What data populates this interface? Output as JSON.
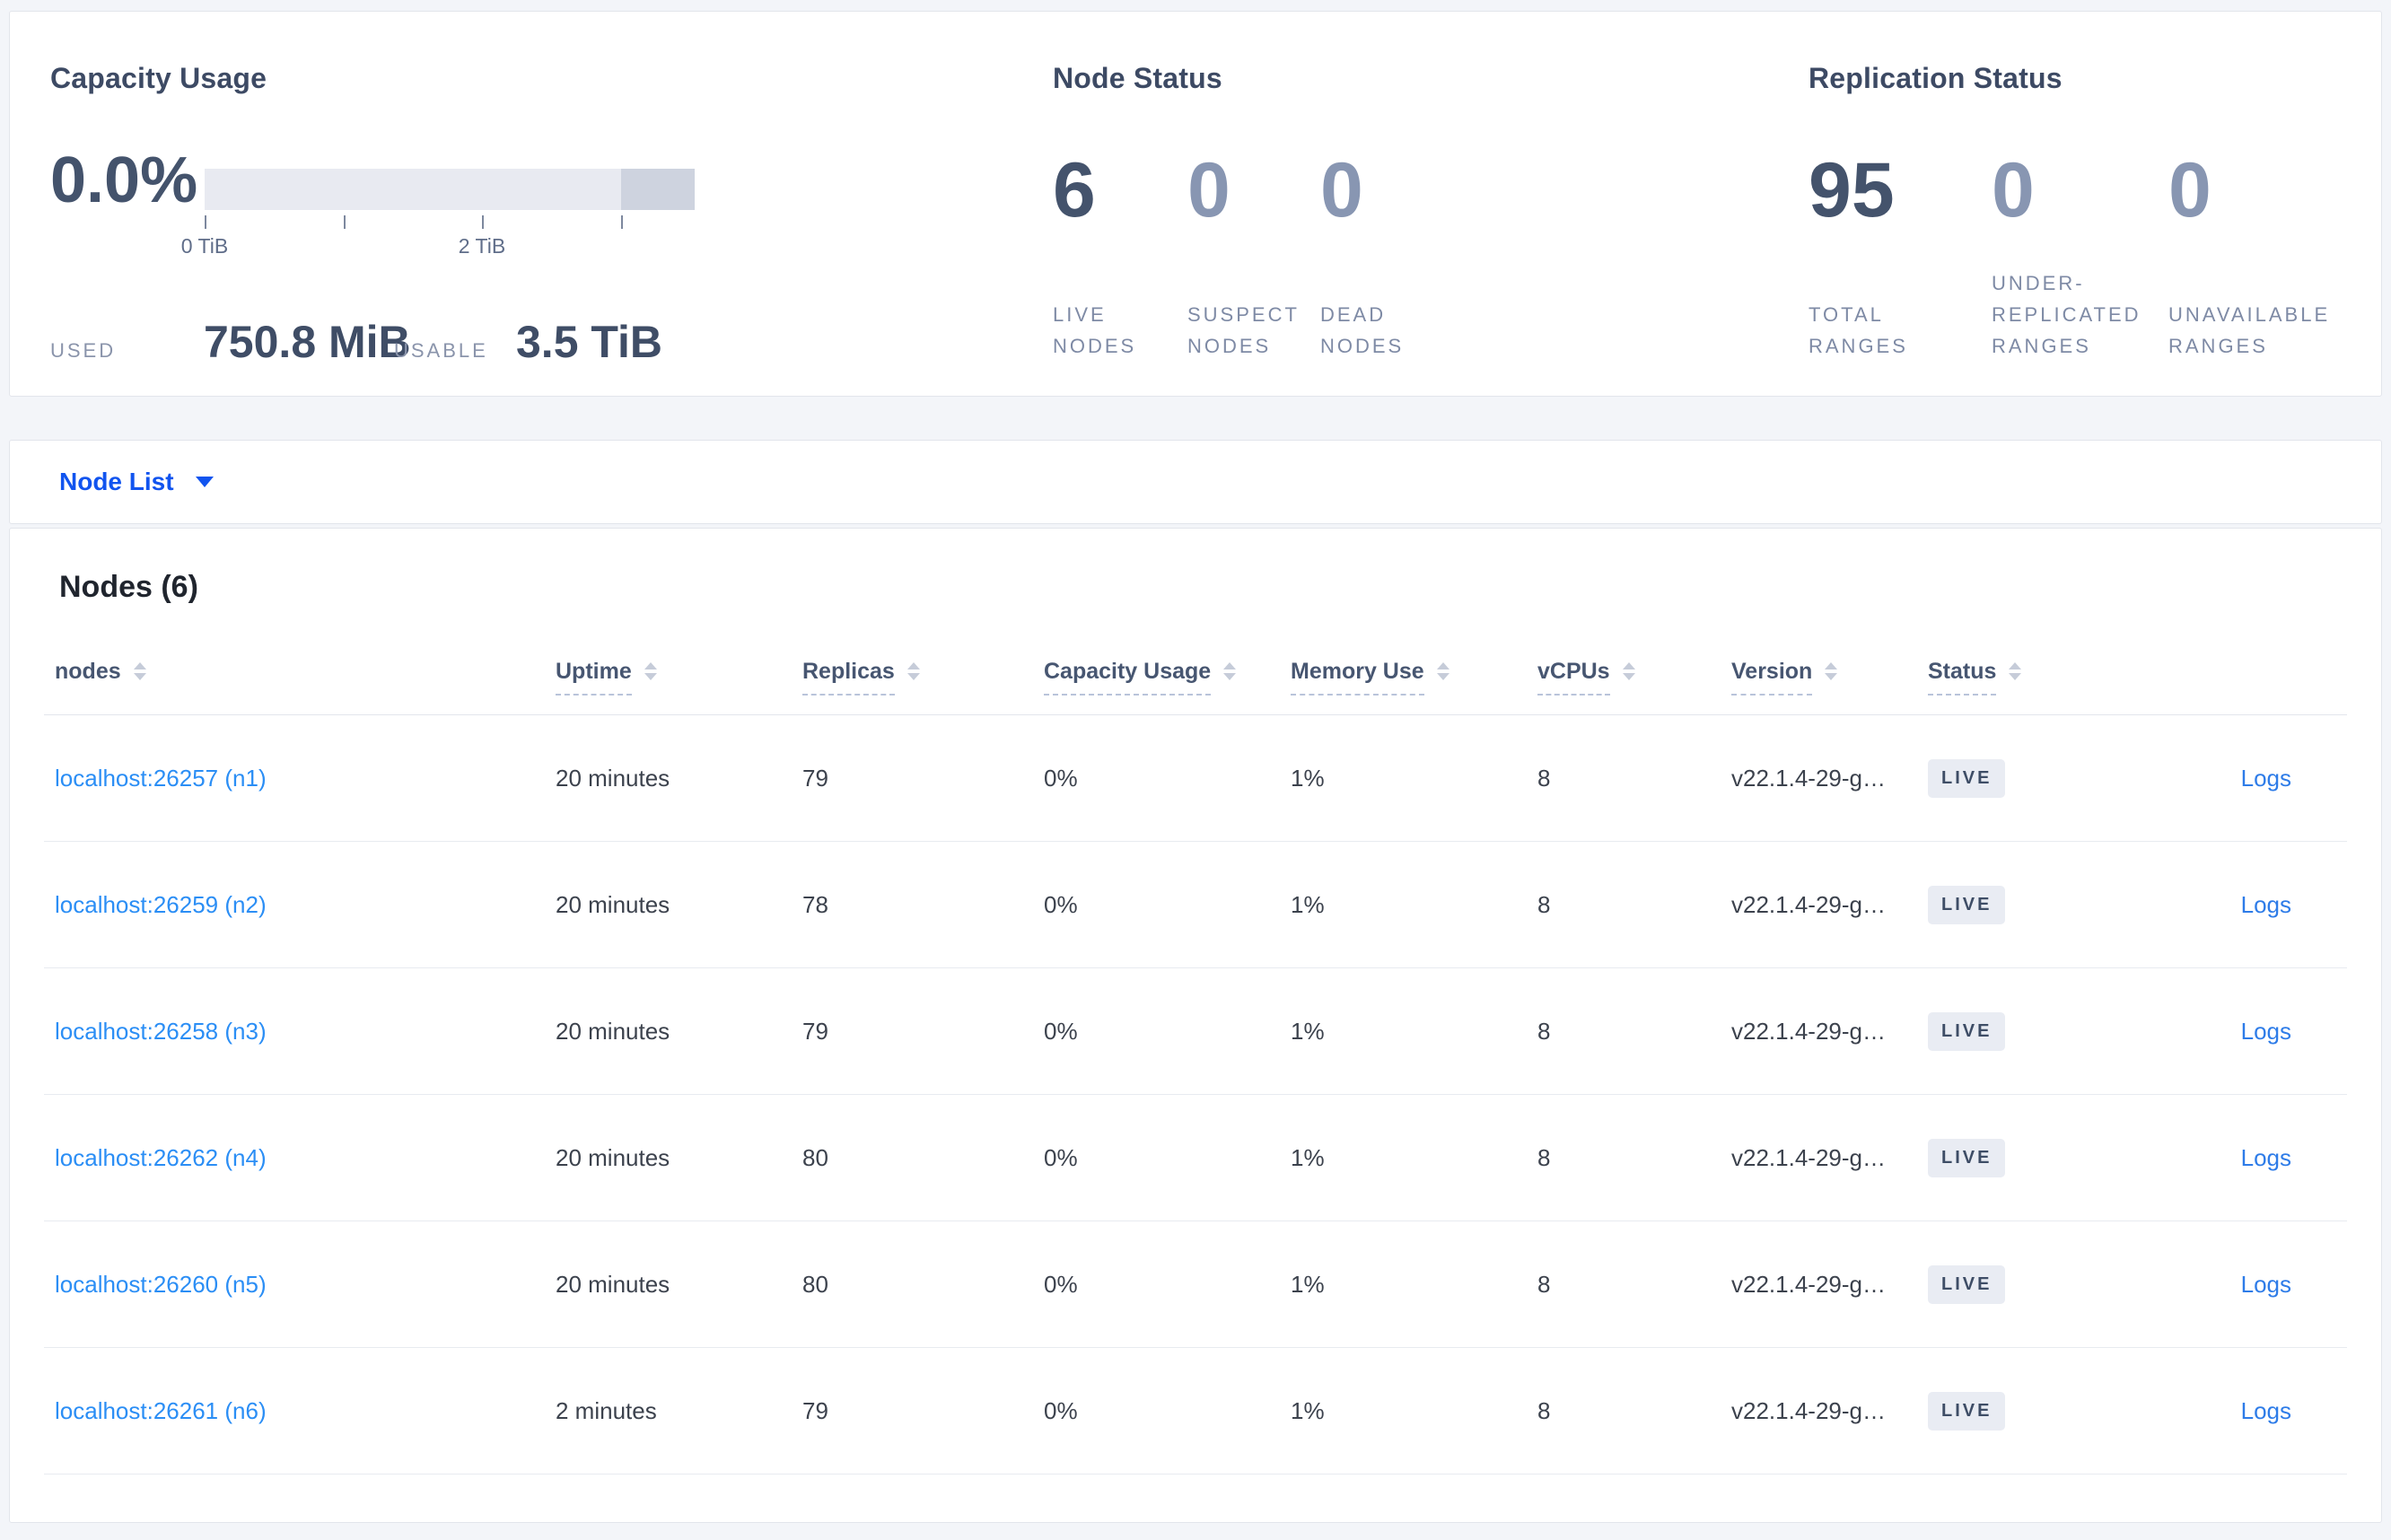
{
  "summary": {
    "capacity": {
      "title": "Capacity Usage",
      "percent": "0.0%",
      "axis_labels": [
        "0 TiB",
        "2 TiB"
      ],
      "used_label": "USED",
      "used_value": "750.8 MiB",
      "usable_label": "USABLE",
      "usable_value": "3.5 TiB"
    },
    "node_status": {
      "title": "Node Status",
      "stats": [
        {
          "value": "6",
          "label": "LIVE NODES"
        },
        {
          "value": "0",
          "label": "SUSPECT NODES"
        },
        {
          "value": "0",
          "label": "DEAD NODES"
        }
      ]
    },
    "replication": {
      "title": "Replication Status",
      "stats": [
        {
          "value": "95",
          "label": "TOTAL RANGES"
        },
        {
          "value": "0",
          "label": "UNDER-REPLICATED RANGES"
        },
        {
          "value": "0",
          "label": "UNAVAILABLE RANGES"
        }
      ]
    }
  },
  "node_list": {
    "dropdown_label": "Node List"
  },
  "nodes_panel": {
    "title": "Nodes (6)",
    "columns": [
      {
        "label": "nodes"
      },
      {
        "label": "Uptime"
      },
      {
        "label": "Replicas"
      },
      {
        "label": "Capacity Usage"
      },
      {
        "label": "Memory Use"
      },
      {
        "label": "vCPUs"
      },
      {
        "label": "Version"
      },
      {
        "label": "Status"
      }
    ],
    "rows": [
      {
        "node": "localhost:26257 (n1)",
        "uptime": "20 minutes",
        "replicas": "79",
        "capacity_usage": "0%",
        "memory_use": "1%",
        "vcpus": "8",
        "version": "v22.1.4-29-g…",
        "status": "LIVE",
        "logs": "Logs"
      },
      {
        "node": "localhost:26259 (n2)",
        "uptime": "20 minutes",
        "replicas": "78",
        "capacity_usage": "0%",
        "memory_use": "1%",
        "vcpus": "8",
        "version": "v22.1.4-29-g…",
        "status": "LIVE",
        "logs": "Logs"
      },
      {
        "node": "localhost:26258 (n3)",
        "uptime": "20 minutes",
        "replicas": "79",
        "capacity_usage": "0%",
        "memory_use": "1%",
        "vcpus": "8",
        "version": "v22.1.4-29-g…",
        "status": "LIVE",
        "logs": "Logs"
      },
      {
        "node": "localhost:26262 (n4)",
        "uptime": "20 minutes",
        "replicas": "80",
        "capacity_usage": "0%",
        "memory_use": "1%",
        "vcpus": "8",
        "version": "v22.1.4-29-g…",
        "status": "LIVE",
        "logs": "Logs"
      },
      {
        "node": "localhost:26260 (n5)",
        "uptime": "20 minutes",
        "replicas": "80",
        "capacity_usage": "0%",
        "memory_use": "1%",
        "vcpus": "8",
        "version": "v22.1.4-29-g…",
        "status": "LIVE",
        "logs": "Logs"
      },
      {
        "node": "localhost:26261 (n6)",
        "uptime": "2 minutes",
        "replicas": "79",
        "capacity_usage": "0%",
        "memory_use": "1%",
        "vcpus": "8",
        "version": "v22.1.4-29-g…",
        "status": "LIVE",
        "logs": "Logs"
      }
    ]
  },
  "colors": {
    "page_background": "#f3f5f9",
    "card_border": "#e2e5eb",
    "heading_navy": "#3d4a64",
    "stat_strong": "#44536c",
    "stat_muted": "#8896b2",
    "caps_label_gray": "#7e8aa5",
    "bar_light_gray": "#e8eaf1",
    "bar_dark_gray": "#ced3df",
    "dropdown_blue": "#1154ef",
    "node_link_blue": "#2b8ef5",
    "logs_link_blue": "#2e7ce8",
    "badge_background": "#e9ecf3",
    "badge_text": "#3e4d66",
    "row_divider": "#e8ebf0"
  }
}
